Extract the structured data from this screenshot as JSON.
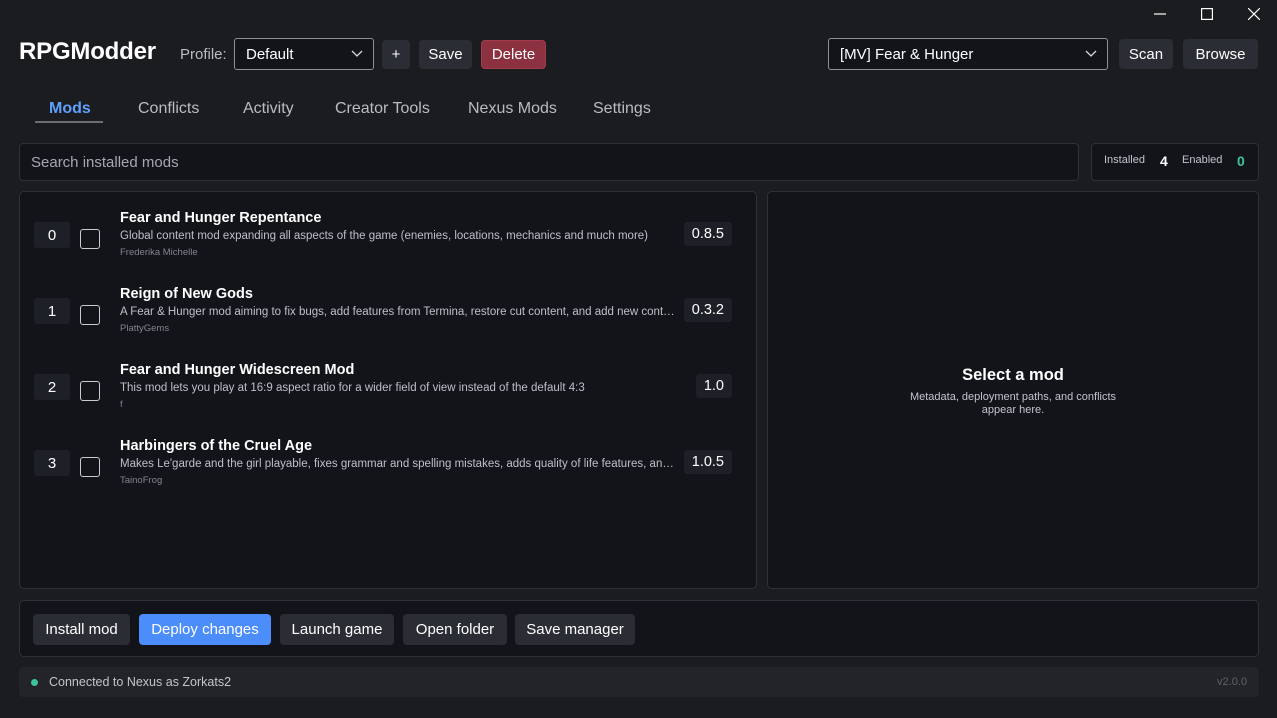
{
  "window": {
    "controls": [
      {
        "name": "minimize-button",
        "icon": "minimize-icon"
      },
      {
        "name": "maximize-button",
        "icon": "maximize-icon"
      },
      {
        "name": "close-button",
        "icon": "close-icon"
      }
    ]
  },
  "header": {
    "app_title": "RPGModder",
    "profile_label": "Profile:",
    "profile_value": "Default",
    "add_label": "+",
    "save_label": "Save",
    "delete_label": "Delete",
    "game_value": "[MV] Fear & Hunger",
    "scan_label": "Scan",
    "browse_label": "Browse"
  },
  "tabs": [
    {
      "label": "Mods",
      "active": true
    },
    {
      "label": "Conflicts",
      "active": false
    },
    {
      "label": "Activity",
      "active": false
    },
    {
      "label": "Creator Tools",
      "active": false
    },
    {
      "label": "Nexus Mods",
      "active": false
    },
    {
      "label": "Settings",
      "active": false
    }
  ],
  "search": {
    "placeholder": "Search installed mods"
  },
  "stats": {
    "installed_label": "Installed",
    "installed_value": "4",
    "enabled_label": "Enabled",
    "enabled_value": "0",
    "installed_color": "#ffffff",
    "enabled_color": "#3bc49a"
  },
  "mods": [
    {
      "index": "0",
      "name": "Fear and Hunger Repentance",
      "description": "Global content mod expanding all aspects of the game (enemies, locations, mechanics and much more)",
      "author": "Frederika Michelle",
      "version": "0.8.5",
      "enabled": false
    },
    {
      "index": "1",
      "name": "Reign of New Gods",
      "description": "A Fear & Hunger mod aiming to fix bugs, add features from Termina, restore cut content, and add new content",
      "author": "PlattyGems",
      "version": "0.3.2",
      "enabled": false
    },
    {
      "index": "2",
      "name": "Fear and Hunger Widescreen Mod",
      "description": "This mod lets you play at 16:9 aspect ratio for a wider field of view instead of the default 4:3",
      "author": "f",
      "version": "1.0",
      "enabled": false
    },
    {
      "index": "3",
      "name": "Harbingers of the Cruel Age",
      "description": "Makes Le'garde and the girl playable, fixes grammar and spelling mistakes, adds quality of life features, and more",
      "author": "TainoFrog",
      "version": "1.0.5",
      "enabled": false
    }
  ],
  "detail": {
    "title": "Select a mod",
    "description_line1": "Metadata, deployment paths, and conflicts",
    "description_line2": "appear here."
  },
  "actions": {
    "install_label": "Install mod",
    "deploy_label": "Deploy changes",
    "launch_label": "Launch game",
    "open_folder_label": "Open folder",
    "save_manager_label": "Save manager"
  },
  "status": {
    "text": "Connected to Nexus as Zorkats2",
    "version": "v2.0.0",
    "dot_color": "#3bc49a"
  }
}
